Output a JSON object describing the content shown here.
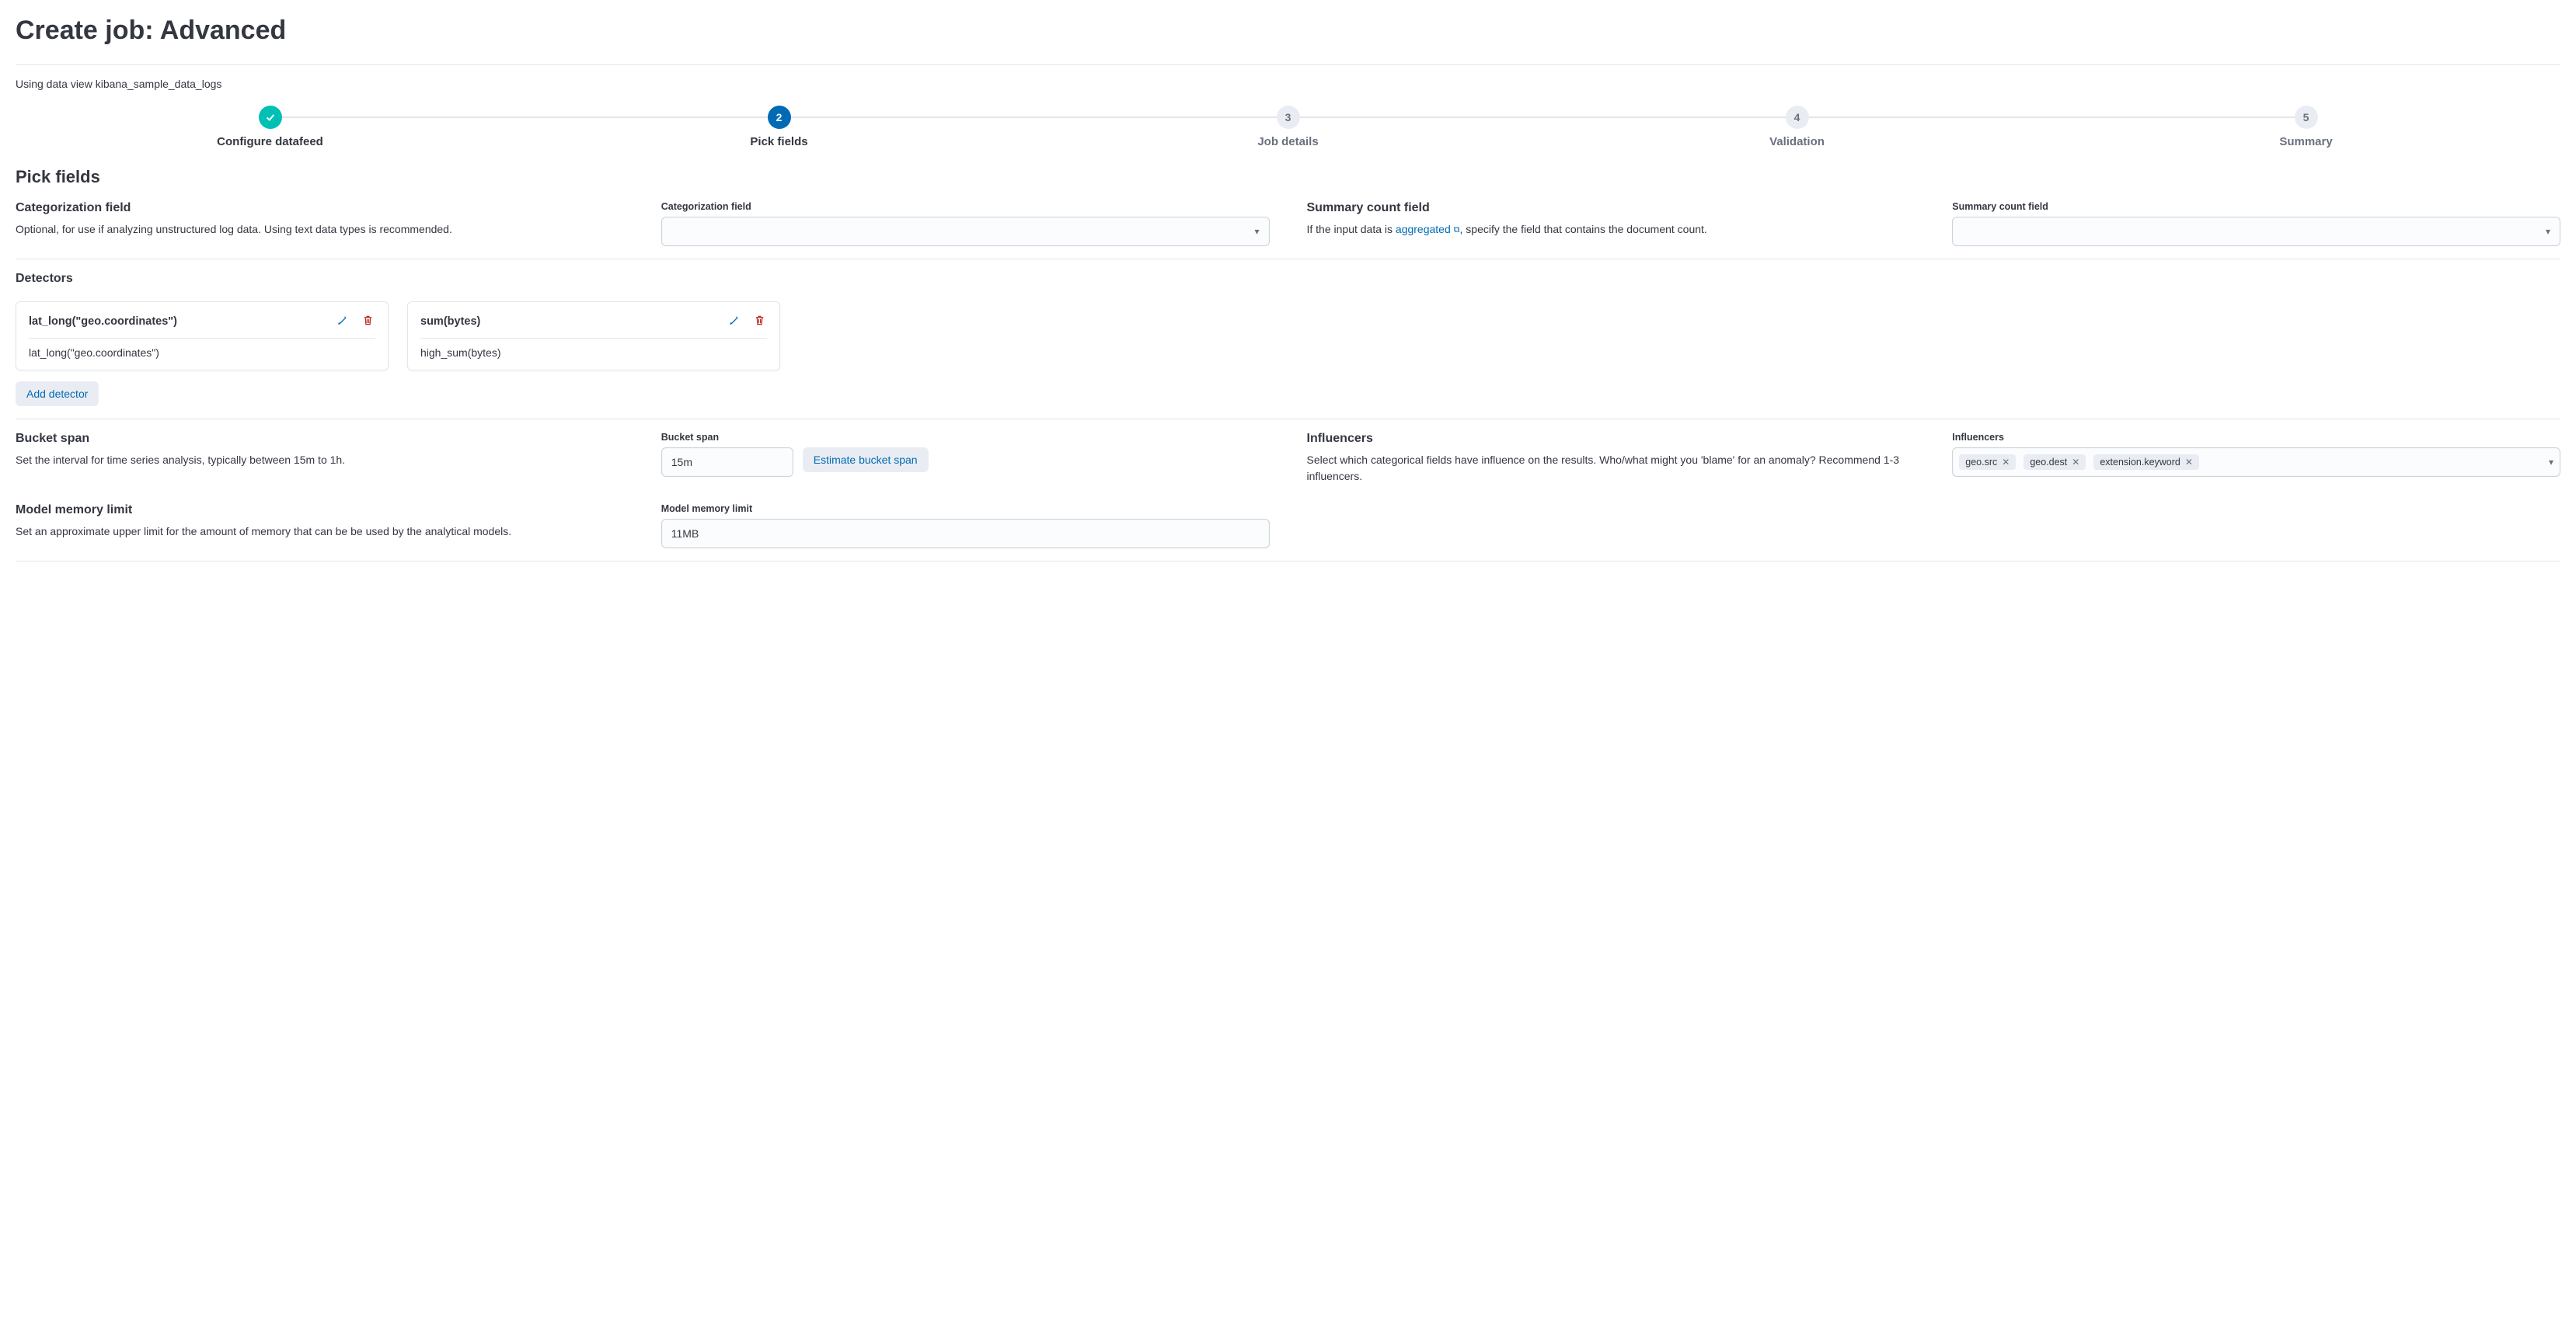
{
  "page_title": "Create job: Advanced",
  "data_view_text": "Using data view kibana_sample_data_logs",
  "steps": [
    {
      "num": "",
      "label": "Configure datafeed",
      "state": "completed"
    },
    {
      "num": "2",
      "label": "Pick fields",
      "state": "current"
    },
    {
      "num": "3",
      "label": "Job details",
      "state": "pending"
    },
    {
      "num": "4",
      "label": "Validation",
      "state": "pending"
    },
    {
      "num": "5",
      "label": "Summary",
      "state": "pending"
    }
  ],
  "section_heading": "Pick fields",
  "categorization": {
    "title": "Categorization field",
    "desc": "Optional, for use if analyzing unstructured log data. Using text data types is recommended.",
    "form_label": "Categorization field"
  },
  "summary_count": {
    "title": "Summary count field",
    "desc_prefix": "If the input data is ",
    "link": "aggregated",
    "desc_suffix": ", specify the field that contains the document count.",
    "form_label": "Summary count field"
  },
  "detectors": {
    "title": "Detectors",
    "items": [
      {
        "title": "lat_long(\"geo.coordinates\")",
        "body": "lat_long(\"geo.coordinates\")"
      },
      {
        "title": "sum(bytes)",
        "body": "high_sum(bytes)"
      }
    ],
    "add_label": "Add detector"
  },
  "bucket_span": {
    "title": "Bucket span",
    "desc": "Set the interval for time series analysis, typically between 15m to 1h.",
    "form_label": "Bucket span",
    "value": "15m",
    "estimate_label": "Estimate bucket span"
  },
  "influencers": {
    "title": "Influencers",
    "desc": "Select which categorical fields have influence on the results. Who/what might you 'blame' for an anomaly? Recommend 1-3 influencers.",
    "form_label": "Influencers",
    "pills": [
      "geo.src",
      "geo.dest",
      "extension.keyword"
    ]
  },
  "model_memory": {
    "title": "Model memory limit",
    "desc": "Set an approximate upper limit for the amount of memory that can be be used by the analytical models.",
    "form_label": "Model memory limit",
    "value": "11MB"
  }
}
